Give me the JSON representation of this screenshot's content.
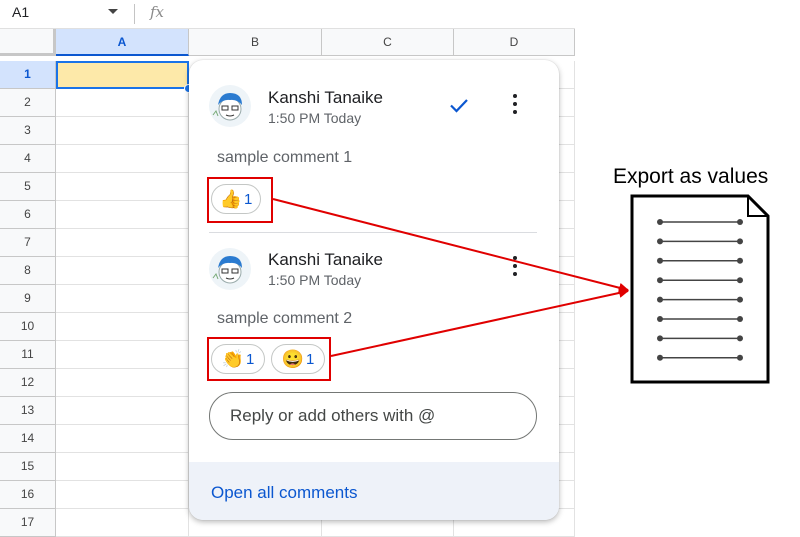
{
  "formula_bar": {
    "name_box": "A1",
    "fx_label": "fx"
  },
  "columns": [
    "A",
    "B",
    "C",
    "D"
  ],
  "rows": [
    "1",
    "2",
    "3",
    "4",
    "5",
    "6",
    "7",
    "8",
    "9",
    "10",
    "11",
    "12",
    "13",
    "14",
    "15",
    "16",
    "17"
  ],
  "comments": [
    {
      "author": "Kanshi Tanaike",
      "time": "1:50 PM Today",
      "text": "sample comment 1",
      "reactions": [
        {
          "emoji": "👍",
          "count": "1"
        }
      ]
    },
    {
      "author": "Kanshi Tanaike",
      "time": "1:50 PM Today",
      "text": "sample comment 2",
      "reactions": [
        {
          "emoji": "👏",
          "count": "1"
        },
        {
          "emoji": "😀",
          "count": "1"
        }
      ]
    }
  ],
  "reply": {
    "placeholder": "Reply or add others with @"
  },
  "footer": {
    "open_all": "Open all comments"
  },
  "annotation": {
    "label": "Export as values",
    "color": "#e00000"
  },
  "colors": {
    "selection_blue": "#1a73e8",
    "link_blue": "#0b57d0",
    "active_cell_fill": "#fde9a9"
  }
}
